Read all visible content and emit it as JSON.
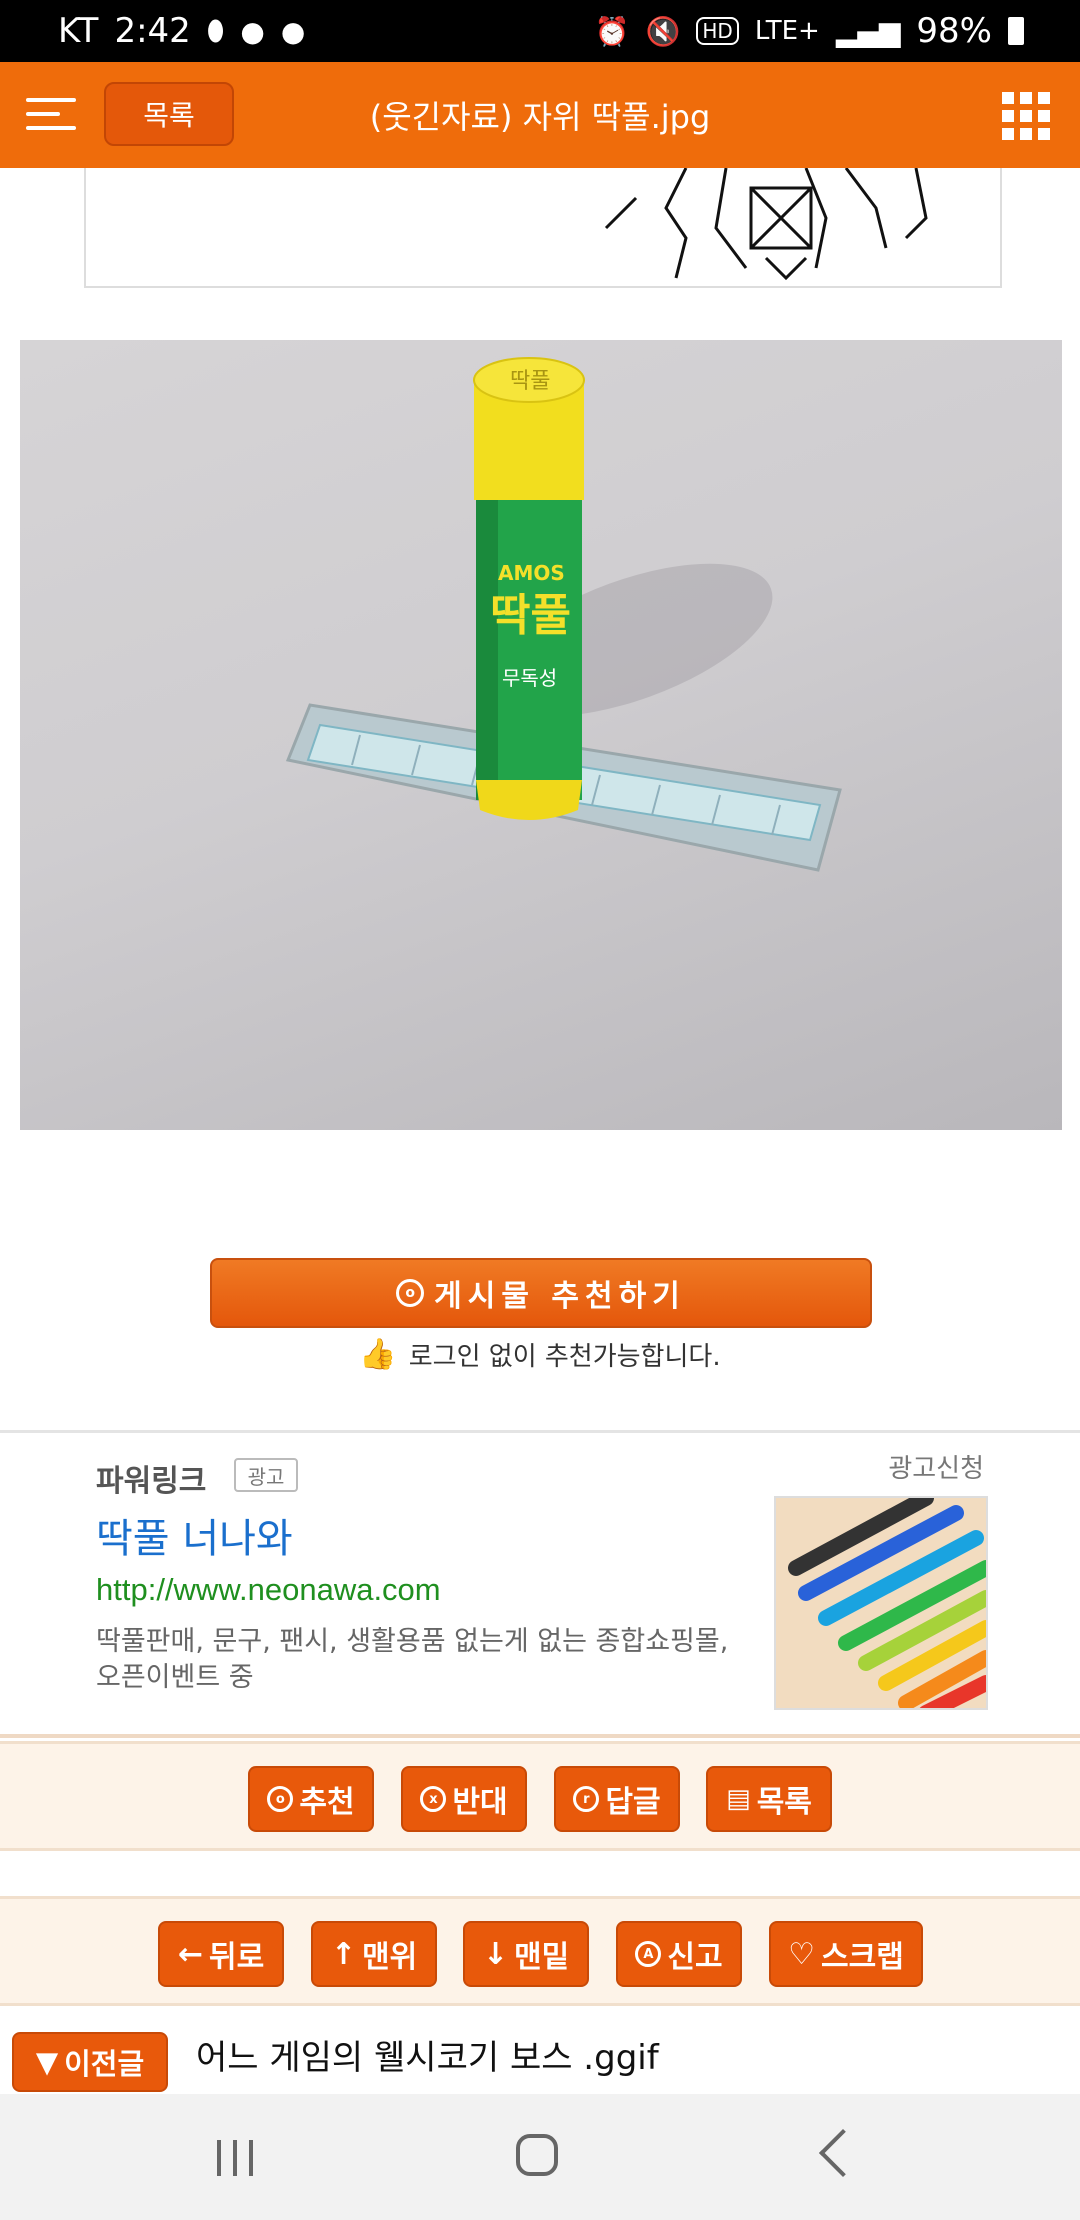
{
  "status_bar": {
    "carrier": "KT",
    "time": "2:42",
    "network": "LTE+",
    "hd_badge": "HD",
    "battery": "98%"
  },
  "header": {
    "list_button": "목록",
    "title": "(웃긴자료) 자위 딱풀.jpg"
  },
  "post": {
    "photo_glue_cap": "딱풀",
    "photo_glue_brand": "AMOS",
    "photo_glue_label": "딱풀",
    "photo_glue_sub": "무독성"
  },
  "recommend": {
    "button_label": "게시물 추천하기",
    "note": "로그인 없이 추천가능합니다."
  },
  "ad": {
    "powerlink": "파워링크",
    "badge": "광고",
    "apply": "광고신청",
    "title": "딱풀 너나와",
    "url": "http://www.neonawa.com",
    "description": "딱풀판매, 문구, 팬시, 생활용품 없는게 없는 종합쇼핑몰, 오픈이벤트 중"
  },
  "action_bar": [
    {
      "icon": "o",
      "label": "추천"
    },
    {
      "icon": "x",
      "label": "반대"
    },
    {
      "icon": "r",
      "label": "답글"
    },
    {
      "icon": "list",
      "label": "목록"
    }
  ],
  "nav_bar_buttons": [
    {
      "icon": "←",
      "label": "뒤로"
    },
    {
      "icon": "↑",
      "label": "맨위"
    },
    {
      "icon": "↓",
      "label": "맨밑"
    },
    {
      "icon": "A",
      "label": "신고"
    },
    {
      "icon": "♡",
      "label": "스크랩"
    }
  ],
  "previous": {
    "button": "이전글",
    "title": "어느 게임의 웰시코기 보스 .ggif"
  },
  "colors": {
    "accent": "#ef6c0b",
    "button": "#e8590b",
    "bar_bg": "#fdf3e8",
    "ad_title": "#1a6fcd",
    "ad_url": "#1f8f1f"
  }
}
